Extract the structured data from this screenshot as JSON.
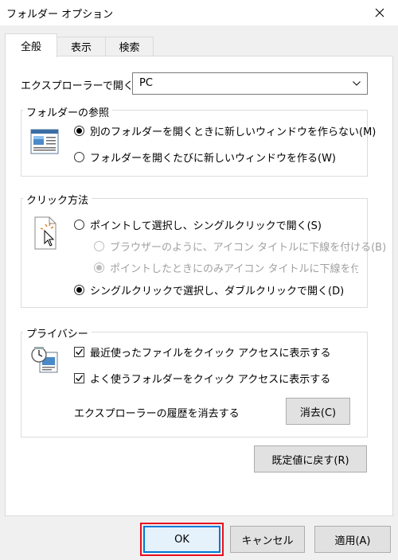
{
  "window": {
    "title": "フォルダー オプション"
  },
  "tabs": [
    "全般",
    "表示",
    "検索"
  ],
  "open_explorer": {
    "label": "エクスプローラーで開く:",
    "value": "PC"
  },
  "browse_group": {
    "title": "フォルダーの参照",
    "options": [
      "別のフォルダーを開くときに新しいウィンドウを作らない(M)",
      "フォルダーを開くたびに新しいウィンドウを作る(W)"
    ],
    "selected": 0
  },
  "click_group": {
    "title": "クリック方法",
    "option_single": "ポイントして選択し、シングルクリックで開く(S)",
    "sub_browser": "ブラウザーのように、アイコン タイトルに下線を付ける(B)",
    "sub_point": "ポイントしたときにのみアイコン タイトルに下線を付ける(P",
    "option_double": "シングルクリックで選択し、ダブルクリックで開く(D)",
    "selected": "double"
  },
  "privacy_group": {
    "title": "プライバシー",
    "check_recent_files": "最近使ったファイルをクイック アクセスに表示する",
    "check_frequent_folders": "よく使うフォルダーをクイック アクセスに表示する",
    "history_label": "エクスプローラーの履歴を消去する",
    "clear_button": "消去(C)"
  },
  "restore_defaults_button": "既定値に戻す(R)",
  "footer": {
    "ok": "OK",
    "cancel": "キャンセル",
    "apply": "適用(A)"
  },
  "colors": {
    "highlight_border": "#e8101f",
    "focus_blue": "#0078d7"
  }
}
